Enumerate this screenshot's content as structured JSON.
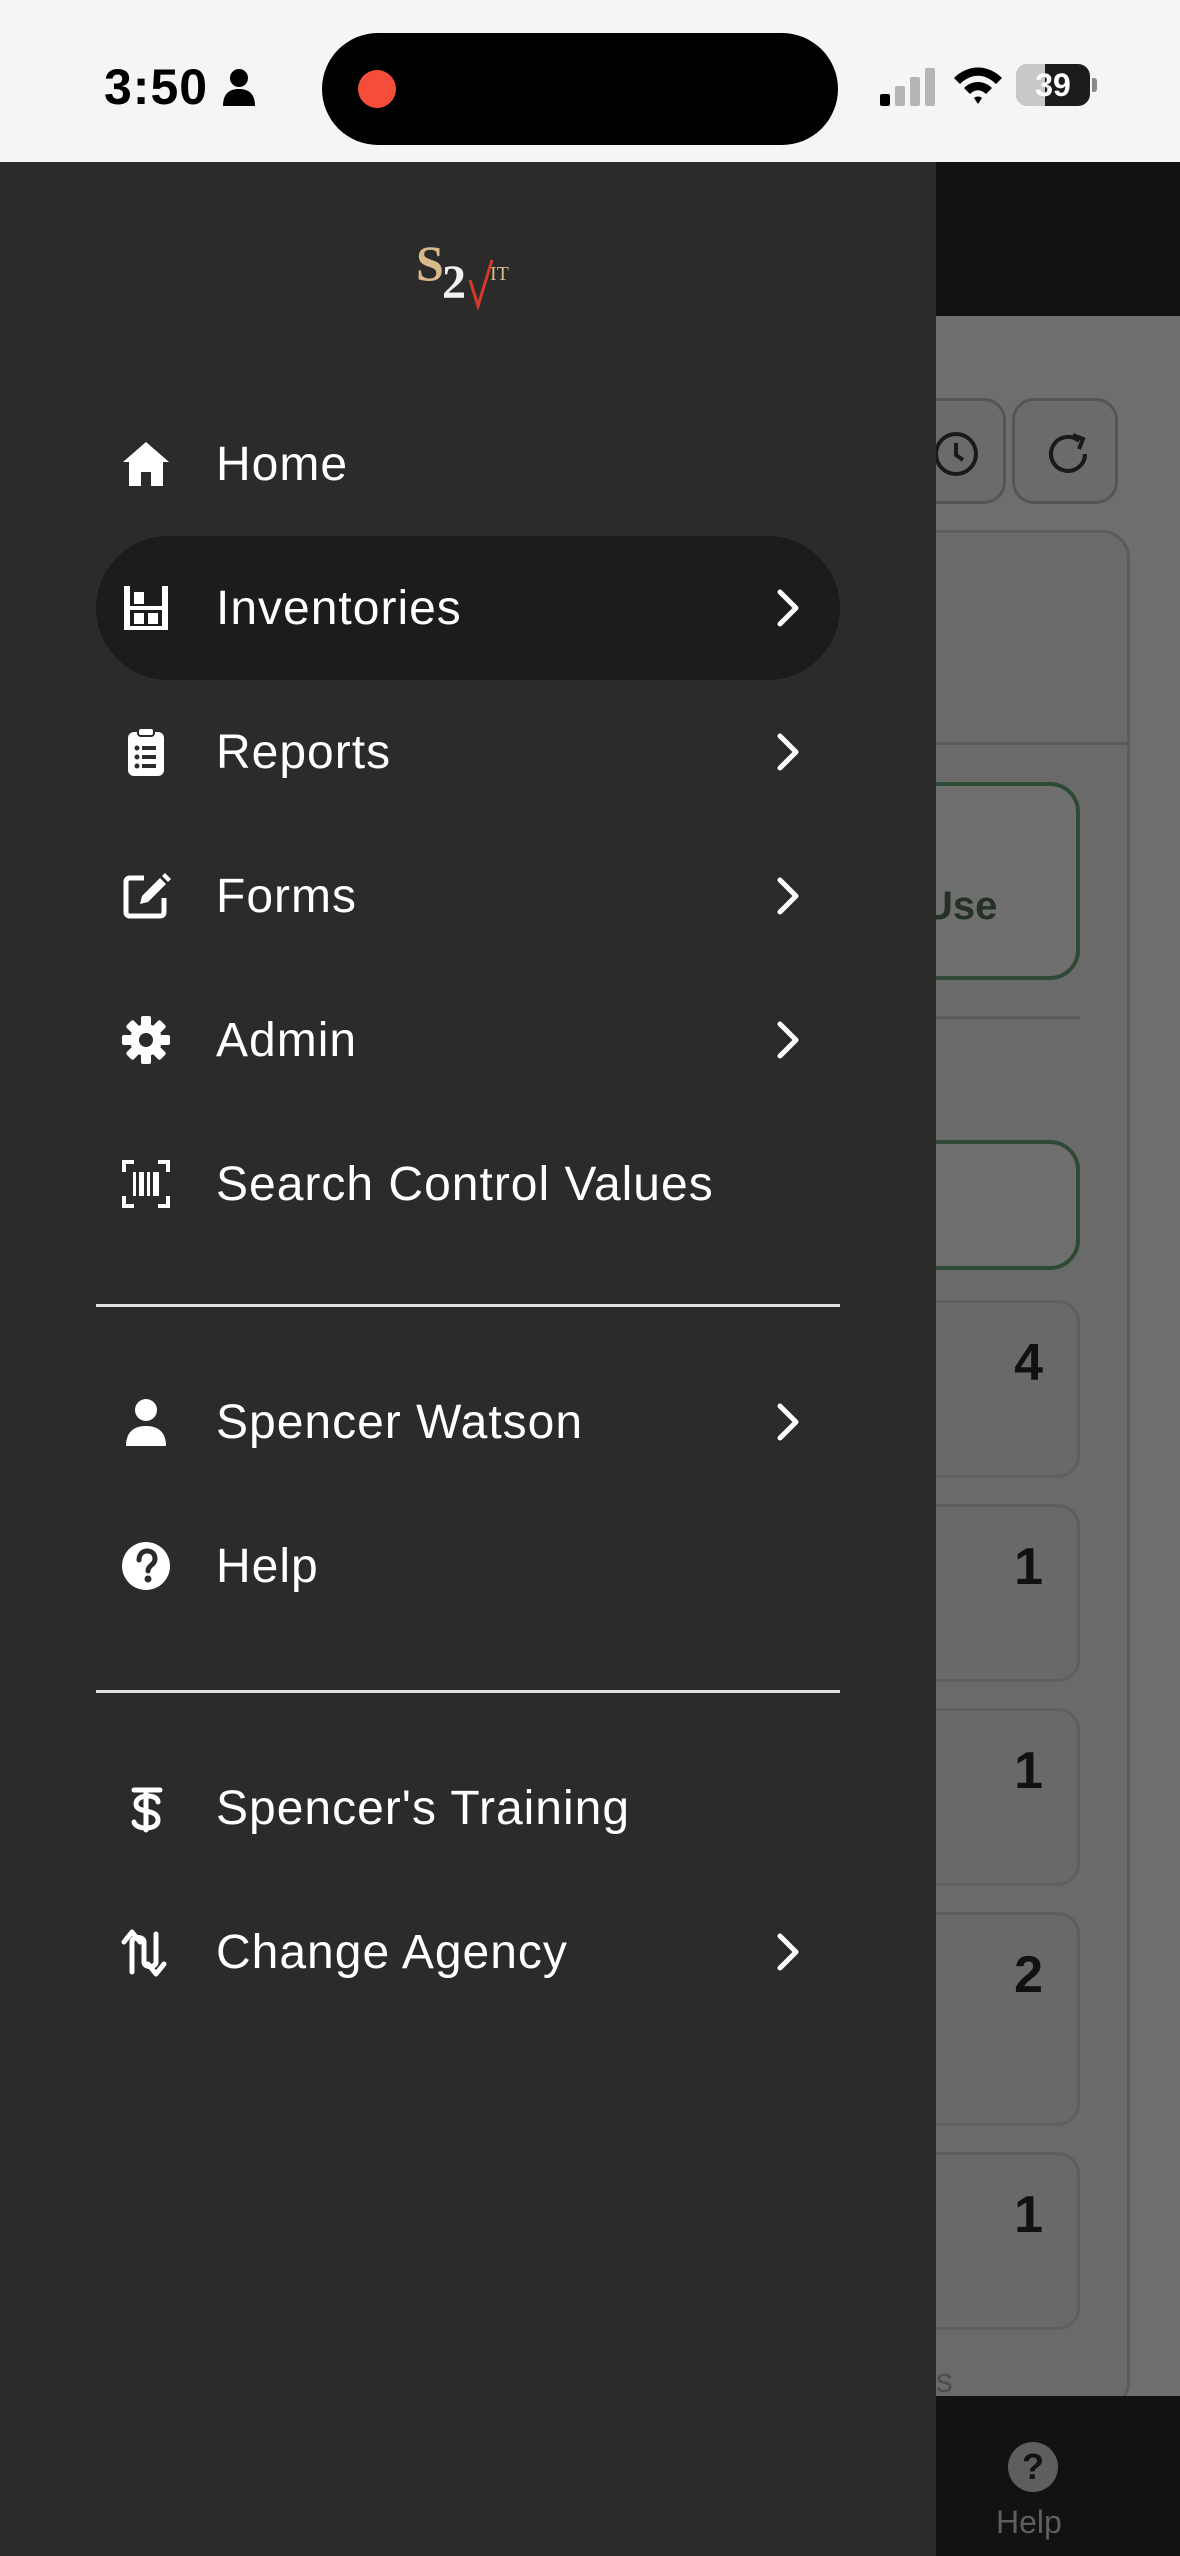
{
  "status_bar": {
    "time": "3:50",
    "battery_level": "39",
    "battery_fraction": 0.39
  },
  "background_app": {
    "partial_button_label": "Use",
    "counts": [
      "4",
      "1",
      "1",
      "2",
      "1"
    ],
    "partial_footer_text": "nes",
    "bottom_nav": {
      "help_label": "Help",
      "help_icon_glyph": "?"
    }
  },
  "drawer": {
    "logo": {
      "alt": "S2 IT logo"
    },
    "items": [
      {
        "label": "Home",
        "icon": "home-icon",
        "has_chevron": false,
        "active": false
      },
      {
        "label": "Inventories",
        "icon": "warehouse-icon",
        "has_chevron": true,
        "active": true
      },
      {
        "label": "Reports",
        "icon": "clipboard-list-icon",
        "has_chevron": true,
        "active": false
      },
      {
        "label": "Forms",
        "icon": "edit-square-icon",
        "has_chevron": true,
        "active": false
      },
      {
        "label": "Admin",
        "icon": "gear-icon",
        "has_chevron": true,
        "active": false
      },
      {
        "label": "Search Control Values",
        "icon": "barcode-scan-icon",
        "has_chevron": false,
        "active": false
      }
    ],
    "account_items": [
      {
        "label": "Spencer Watson",
        "icon": "user-icon",
        "has_chevron": true
      },
      {
        "label": "Help",
        "icon": "help-circle-icon",
        "has_chevron": false
      }
    ],
    "agency_items": [
      {
        "label": "Spencer's Training",
        "icon": "agency-icon",
        "has_chevron": false
      },
      {
        "label": "Change Agency",
        "icon": "swap-icon",
        "has_chevron": true
      }
    ]
  },
  "colors": {
    "drawer_bg": "#2b2b2b",
    "active_item_bg": "#1c1c1c",
    "record_dot": "#f44e3b"
  }
}
